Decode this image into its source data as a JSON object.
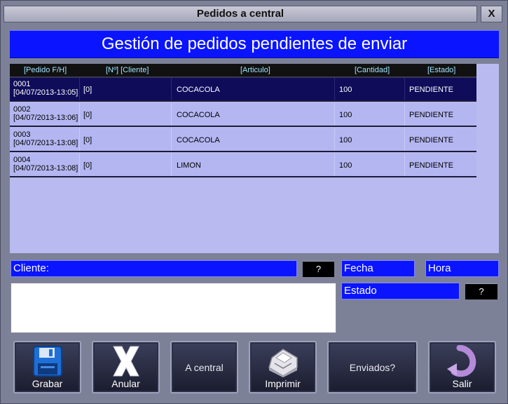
{
  "window": {
    "title": "Pedidos a central",
    "close_label": "X"
  },
  "header": {
    "title": "Gestión de pedidos pendientes de enviar"
  },
  "grid": {
    "columns": [
      "[Pedido F/H]",
      "[Nº] [Cliente]",
      "[Articulo]",
      "[Cantidad]",
      "[Estado]"
    ],
    "rows": [
      {
        "id": "0001",
        "datetime": "[04/07/2013-13:05]",
        "client": "[0]",
        "article": "COCACOLA",
        "qty": "100",
        "status": "PENDIENTE"
      },
      {
        "id": "0002",
        "datetime": "[04/07/2013-13:06]",
        "client": "[0]",
        "article": "COCACOLA",
        "qty": "100",
        "status": "PENDIENTE"
      },
      {
        "id": "0003",
        "datetime": "[04/07/2013-13:08]",
        "client": "[0]",
        "article": "COCACOLA",
        "qty": "100",
        "status": "PENDIENTE"
      },
      {
        "id": "0004",
        "datetime": "[04/07/2013-13:08]",
        "client": "[0]",
        "article": "LIMON",
        "qty": "100",
        "status": "PENDIENTE"
      }
    ]
  },
  "form": {
    "cliente_label": "Cliente:",
    "cliente_query": "?",
    "fecha_label": "Fecha",
    "hora_label": "Hora",
    "estado_label": "Estado",
    "estado_query": "?",
    "notes": ""
  },
  "buttons": {
    "grabar": "Grabar",
    "anular": "Anular",
    "a_central": "A central",
    "imprimir": "Imprimir",
    "enviados": "Enviados?",
    "salir": "Salir"
  },
  "icons": {
    "grabar": "floppy-disk-icon",
    "anular": "x-icon",
    "imprimir": "printer-icon",
    "salir": "exit-arrow-icon"
  },
  "colors": {
    "accent": "#0a14ff",
    "selected_row": "#0f0d5a",
    "row": "#b3b6f0",
    "grid_bg": "#b9baef"
  }
}
